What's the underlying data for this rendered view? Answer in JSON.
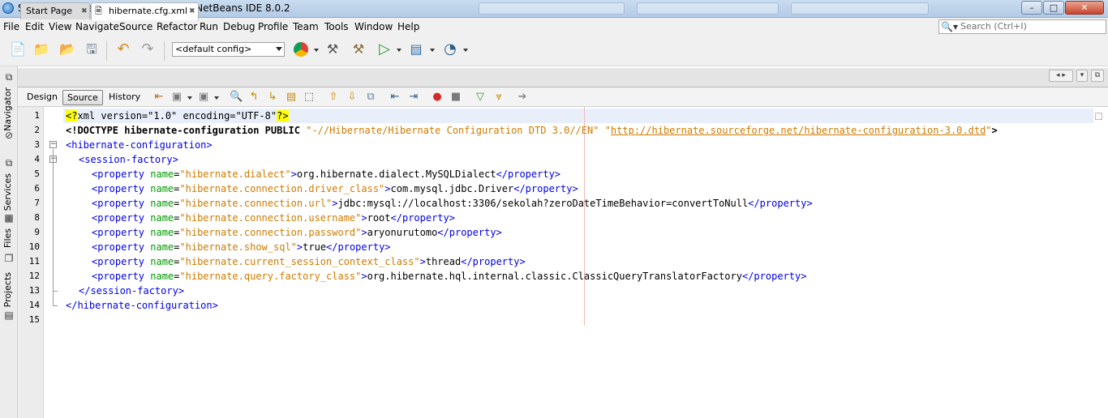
{
  "window": {
    "title": "SekolahHibernatePrimefacesCRUD - NetBeans IDE 8.0.2",
    "minimize": "–",
    "maximize": "□",
    "close": "✕"
  },
  "menu": [
    "File",
    "Edit",
    "View",
    "Navigate",
    "Source",
    "Refactor",
    "Run",
    "Debug",
    "Profile",
    "Team",
    "Tools",
    "Window",
    "Help"
  ],
  "search": {
    "placeholder": "Search (Ctrl+I)",
    "icon": "search-icon"
  },
  "toolbar": {
    "config_value": "<default config>"
  },
  "side_panels": [
    "Navigator",
    "Services",
    "Files",
    "Projects"
  ],
  "tabs": [
    {
      "label": "Start Page",
      "active": false
    },
    {
      "label": "hibernate.cfg.xml",
      "active": true
    }
  ],
  "editor_modes": [
    "Design",
    "Source",
    "History"
  ],
  "selected_mode": "Source",
  "colors": {
    "tag": "#0000e6",
    "attr_name": "#009900",
    "attr_value": "#ce7b00",
    "pi_highlight": "#ffff00",
    "current_line": "#e9effa"
  },
  "code": {
    "line_numbers": [
      "1",
      "2",
      "3",
      "4",
      "5",
      "6",
      "7",
      "8",
      "9",
      "10",
      "11",
      "12",
      "13",
      "14",
      "15"
    ],
    "l1": {
      "pi_open": "<?",
      "a": "xml version=\"1.0\" encoding=\"UTF-8\"",
      "pi_close": "?>"
    },
    "l2": {
      "doctype": "<!DOCTYPE hibernate-configuration PUBLIC ",
      "pub": "\"-//Hibernate/Hibernate Configuration DTD 3.0//EN\"",
      "sp": " ",
      "q1": "\"",
      "url": "http://hibernate.sourceforge.net/hibernate-configuration-3.0.dtd",
      "q2": "\"",
      "end": ">"
    },
    "l3": {
      "tag": "<hibernate-configuration>"
    },
    "l4": {
      "tag": "<session-factory>"
    },
    "props": [
      {
        "name": "hibernate.dialect",
        "value": "org.hibernate.dialect.MySQLDialect"
      },
      {
        "name": "hibernate.connection.driver_class",
        "value": "com.mysql.jdbc.Driver"
      },
      {
        "name": "hibernate.connection.url",
        "value": "jdbc:mysql://localhost:3306/sekolah?zeroDateTimeBehavior=convertToNull"
      },
      {
        "name": "hibernate.connection.username",
        "value": "root"
      },
      {
        "name": "hibernate.connection.password",
        "value": "aryonurutomo"
      },
      {
        "name": "hibernate.show_sql",
        "value": "true"
      },
      {
        "name": "hibernate.current_session_context_class",
        "value": "thread"
      },
      {
        "name": "hibernate.query.factory_class",
        "value": "org.hibernate.hql.internal.classic.ClassicQueryTranslatorFactory"
      }
    ],
    "prop_open": "<property ",
    "prop_attr": "name",
    "eq": "=",
    "gt": ">",
    "prop_close": "</property>",
    "l13": {
      "tag": "</session-factory>"
    },
    "l14": {
      "tag": "</hibernate-configuration>"
    }
  }
}
